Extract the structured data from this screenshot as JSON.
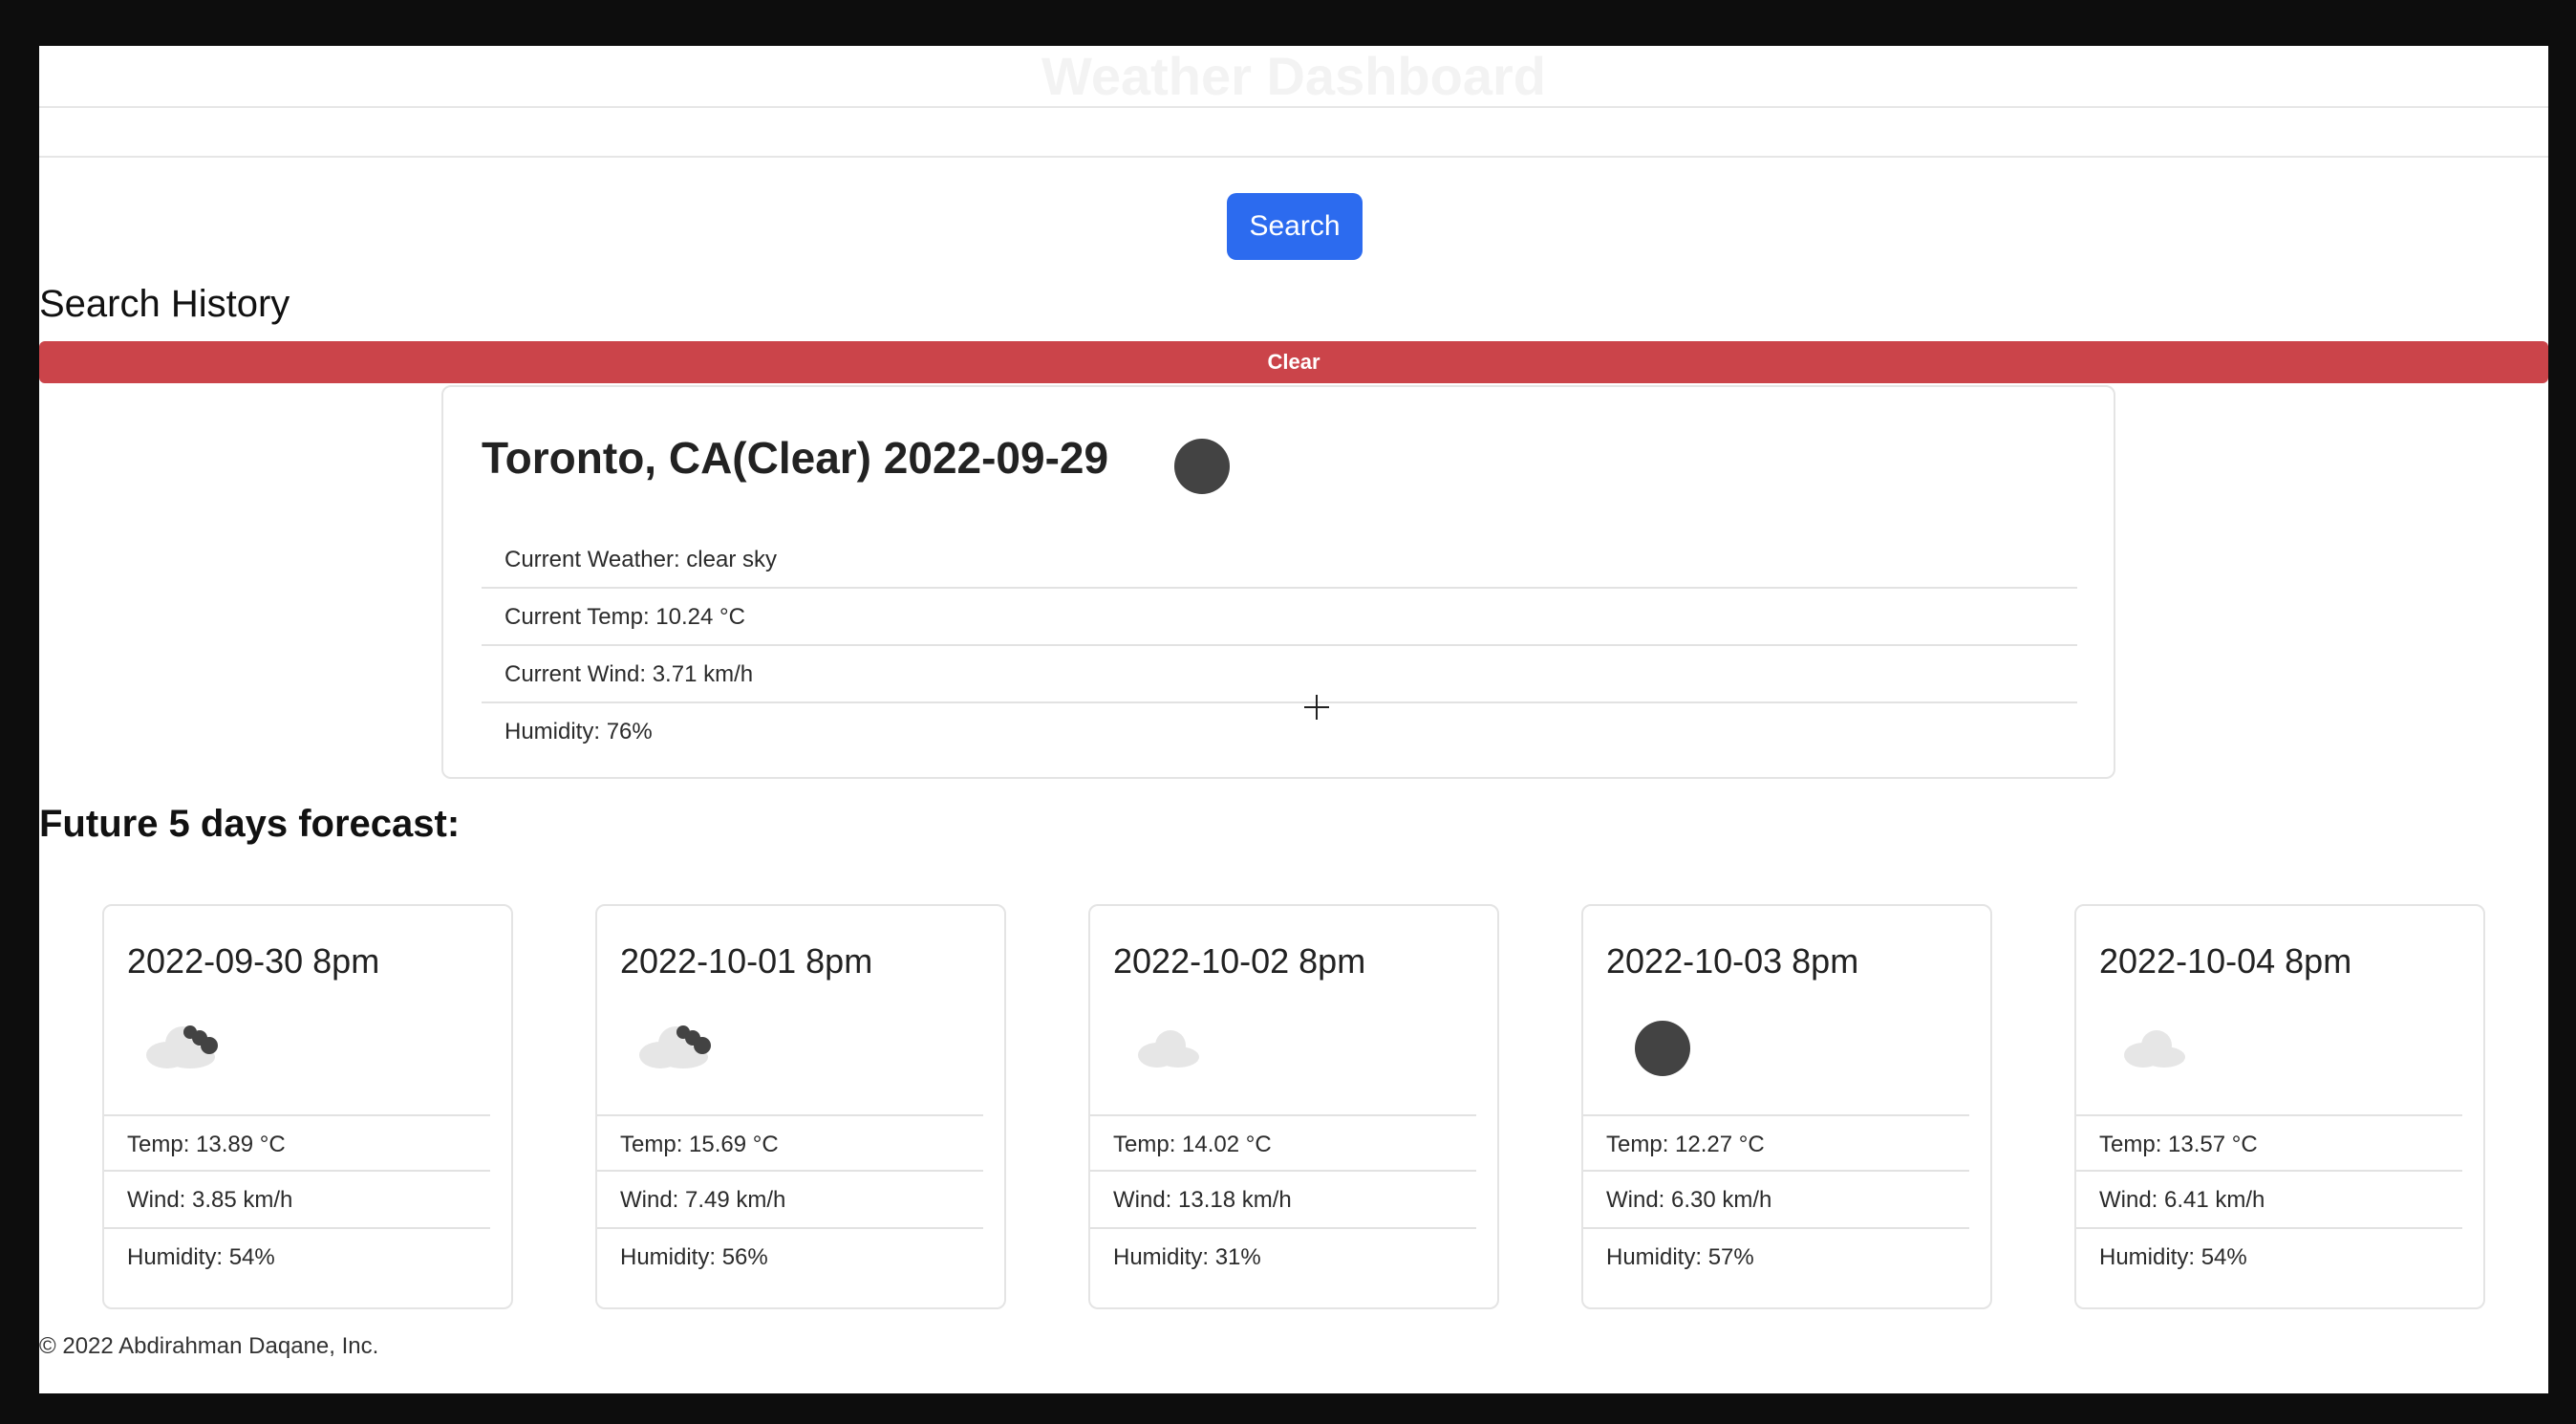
{
  "header": {
    "title": "Weather Dashboard"
  },
  "search": {
    "placeholder": "",
    "value": "",
    "button_label": "Search"
  },
  "history": {
    "title": "Search History",
    "clear_label": "Clear"
  },
  "current": {
    "title": "Toronto, CA(Clear) 2022-09-29",
    "icon": "circle-icon",
    "rows": [
      "Current Weather: clear sky",
      "Current Temp: 10.24 °C",
      "Current Wind: 3.71 km/h",
      "Humidity: 76%"
    ]
  },
  "forecast": {
    "title": "Future 5 days forecast:",
    "days": [
      {
        "date": "2022-09-30 8pm",
        "icon": "cloud-rain-icon",
        "temp": "Temp: 13.89 °C",
        "wind": "Wind: 3.85 km/h",
        "humidity": "Humidity: 54%"
      },
      {
        "date": "2022-10-01 8pm",
        "icon": "cloud-rain-icon",
        "temp": "Temp: 15.69 °C",
        "wind": "Wind: 7.49 km/h",
        "humidity": "Humidity: 56%"
      },
      {
        "date": "2022-10-02 8pm",
        "icon": "cloud-icon",
        "temp": "Temp: 14.02 °C",
        "wind": "Wind: 13.18 km/h",
        "humidity": "Humidity: 31%"
      },
      {
        "date": "2022-10-03 8pm",
        "icon": "circle-icon",
        "temp": "Temp: 12.27 °C",
        "wind": "Wind: 6.30 km/h",
        "humidity": "Humidity: 57%"
      },
      {
        "date": "2022-10-04 8pm",
        "icon": "cloud-icon",
        "temp": "Temp: 13.57 °C",
        "wind": "Wind: 6.41 km/h",
        "humidity": "Humidity: 54%"
      }
    ]
  },
  "footer": {
    "text": "© 2022 Abdirahman Daqane, Inc."
  },
  "colors": {
    "primary": "#2c6bef",
    "danger": "#cb444a",
    "icon_dark": "#434343",
    "cloud": "#e6e6e6"
  }
}
